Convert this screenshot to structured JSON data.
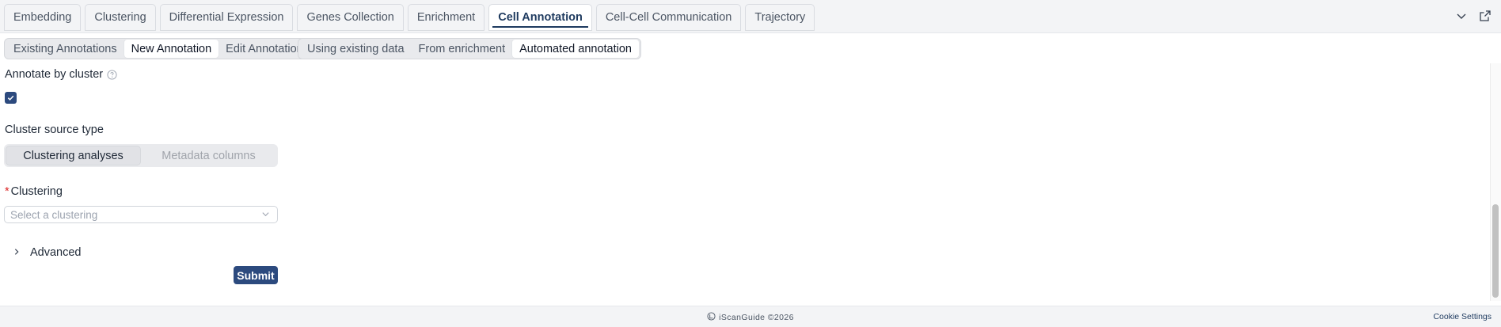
{
  "tabs": [
    {
      "label": "Embedding"
    },
    {
      "label": "Clustering"
    },
    {
      "label": "Differential Expression"
    },
    {
      "label": "Genes Collection"
    },
    {
      "label": "Enrichment"
    },
    {
      "label": "Cell Annotation",
      "active": true
    },
    {
      "label": "Cell-Cell Communication"
    },
    {
      "label": "Trajectory"
    }
  ],
  "annotation_mode": {
    "options": [
      "Existing Annotations",
      "New Annotation",
      "Edit Annotation"
    ],
    "selected": "New Annotation"
  },
  "annotation_method": {
    "options": [
      "Using existing data",
      "From enrichment",
      "Automated annotation"
    ],
    "selected": "Automated annotation"
  },
  "form": {
    "annotate_by_cluster_label": "Annotate by cluster",
    "annotate_by_cluster_checked": true,
    "cluster_source_label": "Cluster source type",
    "cluster_source_options": [
      "Clustering analyses",
      "Metadata columns"
    ],
    "cluster_source_selected": "Clustering analyses",
    "clustering_label": "Clustering",
    "clustering_required_mark": "*",
    "clustering_placeholder": "Select a clustering",
    "advanced_label": "Advanced",
    "submit_label": "Submit"
  },
  "footer": {
    "brand": "iScanGuide ©2026",
    "cookie_settings": "Cookie Settings"
  },
  "icons": {
    "collapse": "chevron-down-icon",
    "external": "external-link-icon",
    "help": "question-circle-icon",
    "advanced": "chevron-right-icon",
    "select": "chevron-down-icon",
    "check": "check-icon",
    "logo": "logo-icon"
  },
  "colors": {
    "primary": "#2c4a7e",
    "active_tab_text": "#1e3a5f",
    "required": "#dc2626"
  }
}
